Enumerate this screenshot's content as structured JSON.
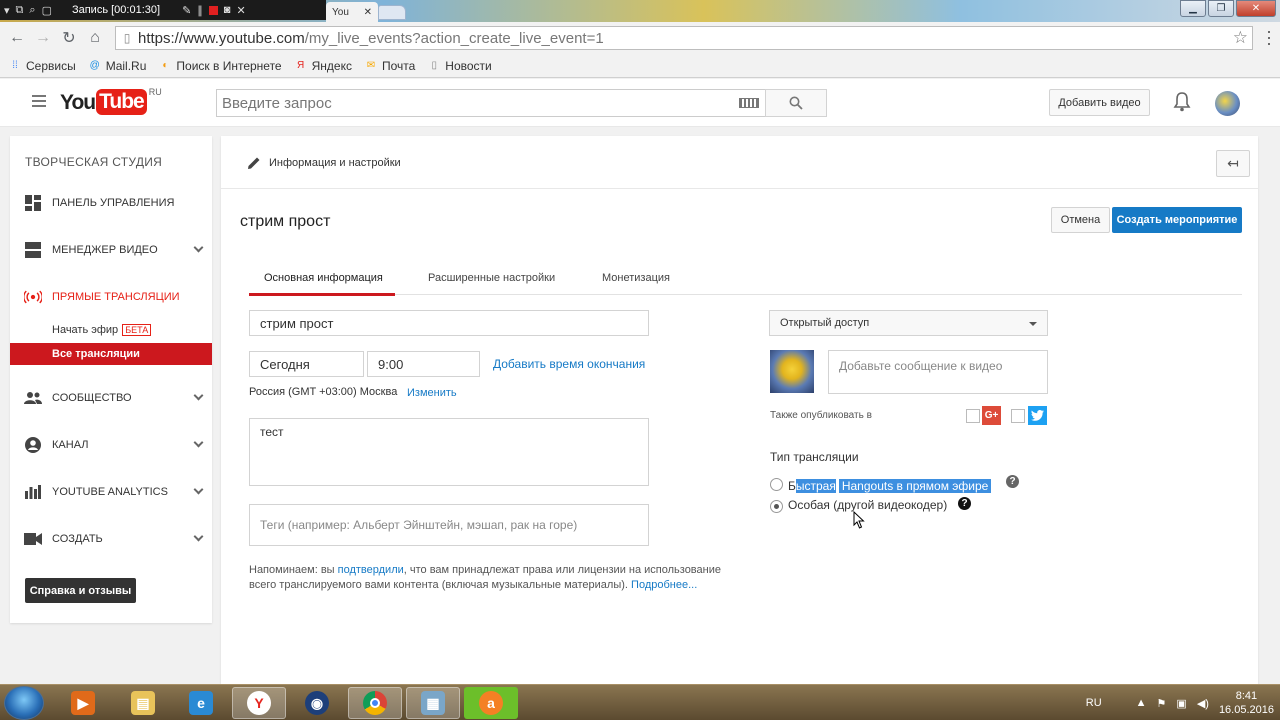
{
  "recorder": {
    "title": "Запись [00:01:30]"
  },
  "browser": {
    "tab_title": "You",
    "url_host": "https://www.youtube.com",
    "url_path": "/my_live_events?action_create_live_event=1",
    "bookmarks": [
      {
        "label": "Сервисы",
        "icon": "apps-grid-icon",
        "color": "#4285f4"
      },
      {
        "label": "Mail.Ru",
        "icon": "mailru-icon",
        "color": "#168de2"
      },
      {
        "label": "Поиск в Интернете",
        "icon": "search-globe-icon",
        "color": "#f39c12"
      },
      {
        "label": "Яндекс",
        "icon": "yandex-icon",
        "color": "#e52620"
      },
      {
        "label": "Почта",
        "icon": "mail-icon",
        "color": "#f7a800"
      },
      {
        "label": "Новости",
        "icon": "page-icon",
        "color": "#888888"
      }
    ]
  },
  "header": {
    "logo_you": "You",
    "logo_tube": "Tube",
    "logo_region": "RU",
    "search_placeholder": "Введите запрос",
    "upload_label": "Добавить видео"
  },
  "sidebar": {
    "title": "ТВОРЧЕСКАЯ СТУДИЯ",
    "items": [
      {
        "label": "ПАНЕЛЬ УПРАВЛЕНИЯ"
      },
      {
        "label": "МЕНЕДЖЕР ВИДЕО"
      },
      {
        "label": "ПРЯМЫЕ ТРАНСЛЯЦИИ"
      },
      {
        "label": "СООБЩЕСТВО"
      },
      {
        "label": "КАНАЛ"
      },
      {
        "label": "YOUTUBE ANALYTICS"
      },
      {
        "label": "СОЗДАТЬ"
      }
    ],
    "sub_start": "Начать эфир",
    "sub_beta": "БЕТА",
    "sub_active": "Все трансляции",
    "help_label": "Справка и отзывы"
  },
  "main": {
    "breadcrumb": "Информация и настройки",
    "event_title": "стрим прост",
    "cancel_label": "Отмена",
    "create_label": "Создать мероприятие",
    "tabs": [
      {
        "label": "Основная информация"
      },
      {
        "label": "Расширенные настройки"
      },
      {
        "label": "Монетизация"
      }
    ],
    "title_value": "стрим прост",
    "date_value": "Сегодня",
    "time_value": "9:00",
    "add_end_time": "Добавить время окончания",
    "timezone": "Россия (GMT +03:00) Москва",
    "timezone_change": "Изменить",
    "description_value": "тест",
    "tags_placeholder": "Теги (например: Альберт Эйнштейн, мэшап, рак на горе)",
    "notice_pre": "Напоминаем: вы ",
    "notice_link": "подтвердили",
    "notice_post": ", что вам принадлежат права или лицензии на использование всего транслируемого вами контента (включая музыкальные материалы). ",
    "notice_more": "Подробнее...",
    "privacy_value": "Открытый доступ",
    "message_placeholder": "Добавьте сообщение к видео",
    "also_publish": "Также опубликовать в",
    "gplus_label": "G+",
    "stream_type_label": "Тип трансляции",
    "option_quick_a": "Б",
    "option_quick_b": "ыстрая",
    "option_quick_c": "Hangouts в прямом эфире",
    "option_custom_a": "Особая (",
    "option_custom_b": "другой видеокодер)",
    "qmark": "?"
  },
  "taskbar": {
    "lang": "RU",
    "time": "8:41",
    "date": "16.05.2016"
  },
  "colors": {
    "yt_red": "#cc181e",
    "blue_link": "#167ac6",
    "selection": "#3d8fe0"
  }
}
